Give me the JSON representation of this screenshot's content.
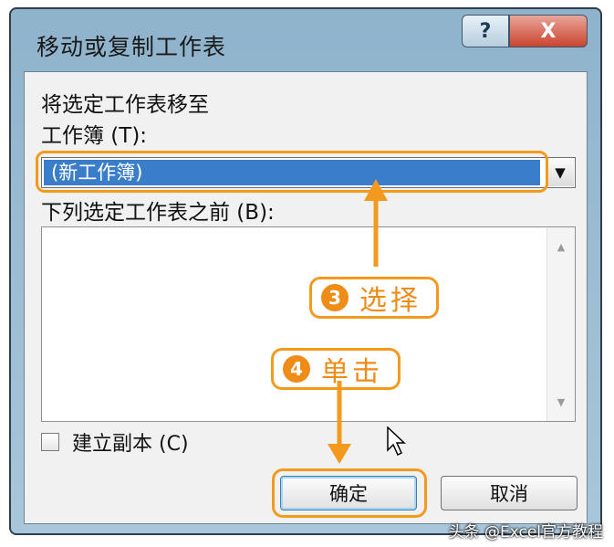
{
  "dialog": {
    "title": "移动或复制工作表",
    "help_button": "?",
    "close_button": "X",
    "move_to_label": "将选定工作表移至",
    "workbook_label": "工作簿 (T):",
    "workbook_value": "(新工作簿)",
    "before_sheet_label": "下列选定工作表之前 (B):",
    "before_sheet_items": [],
    "copy_label": "建立副本 (C)",
    "copy_checked": false,
    "ok_button": "确定",
    "cancel_button": "取消"
  },
  "annotations": {
    "step3_number": "3",
    "step3_text": "选择",
    "step4_number": "4",
    "step4_text": "单击",
    "accent_color": "#f39a1e"
  },
  "watermark": "头条 @Excel官方教程",
  "colors": {
    "selection": "#3a7dc8",
    "close_button": "#c9452f",
    "frame": "#8fb3cc"
  }
}
